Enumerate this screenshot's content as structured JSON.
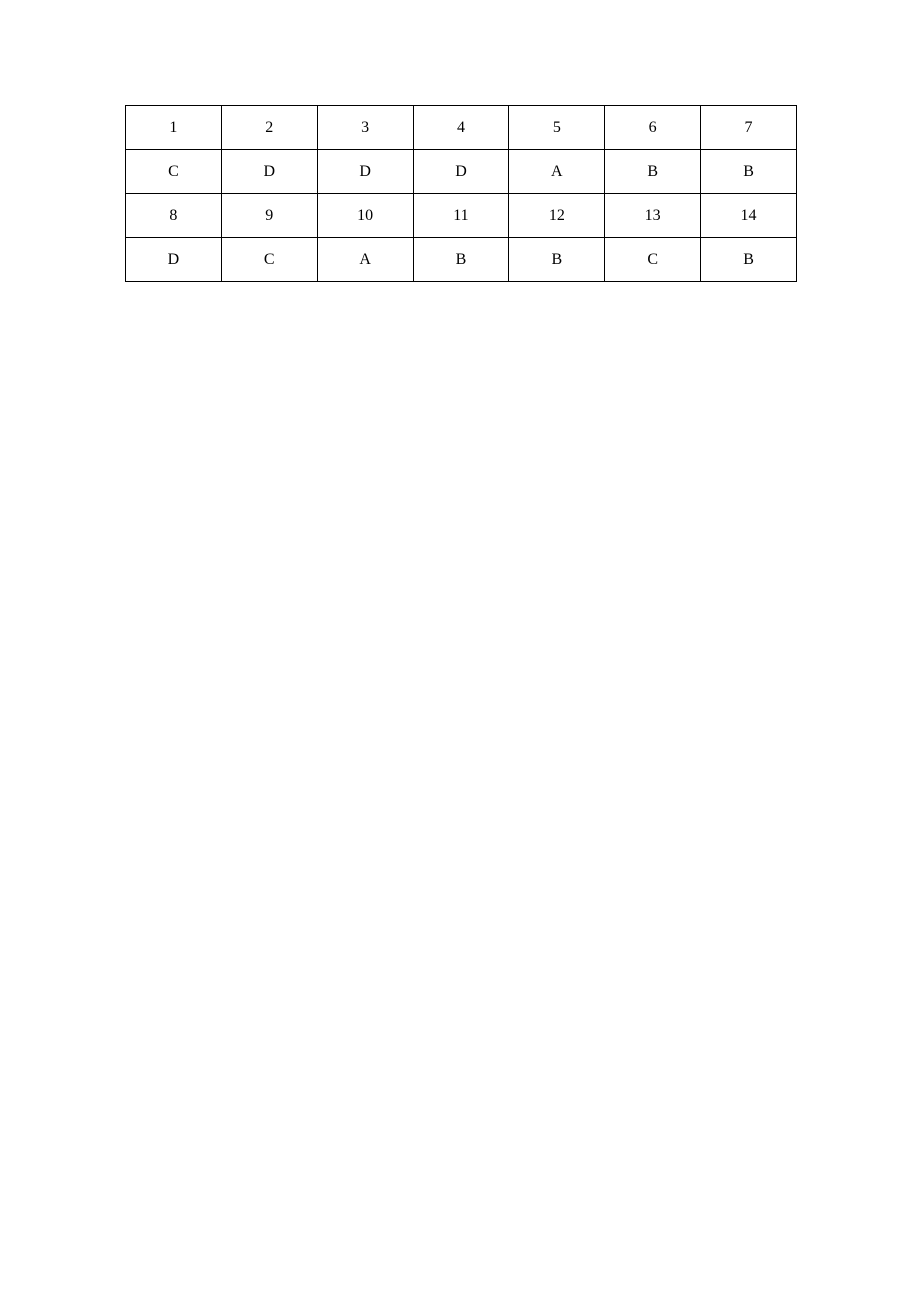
{
  "table": {
    "rows": [
      [
        "1",
        "2",
        "3",
        "4",
        "5",
        "6",
        "7"
      ],
      [
        "C",
        "D",
        "D",
        "D",
        "A",
        "B",
        "B"
      ],
      [
        "8",
        "9",
        "10",
        "11",
        "12",
        "13",
        "14"
      ],
      [
        "D",
        "C",
        "A",
        "B",
        "B",
        "C",
        "B"
      ]
    ]
  }
}
